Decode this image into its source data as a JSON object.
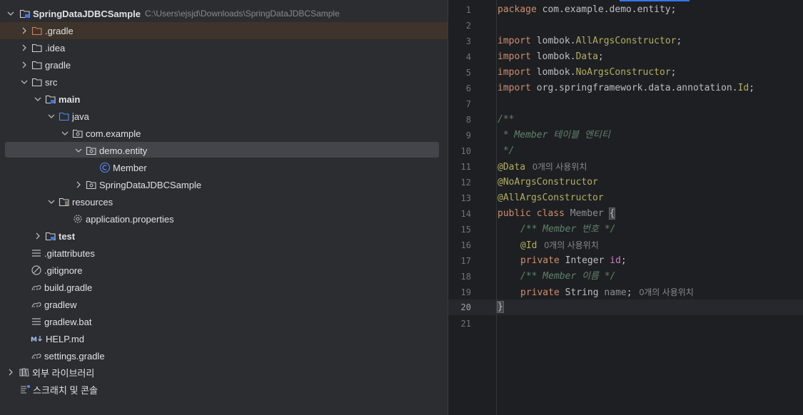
{
  "project_tree": {
    "root": {
      "label": "SpringDataJDBCSample",
      "path": "C:\\Users\\ejsjd\\Downloads\\SpringDataJDBCSample"
    },
    "items": [
      {
        "label": ".gradle",
        "icon": "folder-icon"
      },
      {
        "label": ".idea",
        "icon": "folder-icon"
      },
      {
        "label": "gradle",
        "icon": "folder-icon"
      },
      {
        "label": "src",
        "icon": "folder-icon"
      },
      {
        "label": "main",
        "icon": "module-folder-icon"
      },
      {
        "label": "java",
        "icon": "source-folder-icon"
      },
      {
        "label": "com.example",
        "icon": "package-icon"
      },
      {
        "label": "demo.entity",
        "icon": "package-icon"
      },
      {
        "label": "Member",
        "icon": "class-icon"
      },
      {
        "label": "SpringDataJDBCSample",
        "icon": "package-icon"
      },
      {
        "label": "resources",
        "icon": "resources-folder-icon"
      },
      {
        "label": "application.properties",
        "icon": "gear-icon"
      },
      {
        "label": "test",
        "icon": "module-folder-icon"
      },
      {
        "label": ".gitattributes",
        "icon": "text-file-icon"
      },
      {
        "label": ".gitignore",
        "icon": "ignore-file-icon"
      },
      {
        "label": "build.gradle",
        "icon": "gradle-icon"
      },
      {
        "label": "gradlew",
        "icon": "gradle-icon"
      },
      {
        "label": "gradlew.bat",
        "icon": "text-file-icon"
      },
      {
        "label": "HELP.md",
        "icon": "markdown-icon"
      },
      {
        "label": "settings.gradle",
        "icon": "gradle-icon"
      },
      {
        "label": "외부 라이브러리",
        "icon": "library-icon"
      },
      {
        "label": "스크래치 및 콘솔",
        "icon": "scratch-icon"
      }
    ]
  },
  "editor": {
    "line_numbers": [
      "1",
      "2",
      "3",
      "4",
      "5",
      "6",
      "7",
      "8",
      "9",
      "10",
      "11",
      "12",
      "13",
      "14",
      "15",
      "16",
      "17",
      "18",
      "19",
      "20",
      "21"
    ],
    "current_line": "20",
    "lines": {
      "l1": {
        "kw": "package",
        "rest": " com.example.demo.entity;"
      },
      "l3": {
        "kw": "import",
        "pkg": " lombok.",
        "name": "AllArgsConstructor",
        "end": ";"
      },
      "l4": {
        "kw": "import",
        "pkg": " lombok.",
        "name": "Data",
        "end": ";"
      },
      "l5": {
        "kw": "import",
        "pkg": " lombok.",
        "name": "NoArgsConstructor",
        "end": ";"
      },
      "l6": {
        "kw": "import",
        "pkg": " org.springframework.data.annotation.",
        "name": "Id",
        "end": ";"
      },
      "l8": "/**",
      "l9": " * Member 테이블 엔티티",
      "l10": " */",
      "l11": {
        "ann": "@Data",
        "hint": "0개의 사용위치"
      },
      "l12": "@NoArgsConstructor",
      "l13": "@AllArgsConstructor",
      "l14": {
        "kw1": "public",
        "kw2": "class",
        "name": "Member",
        "brace": "{"
      },
      "l15": "/** Member 번호 */",
      "l16": {
        "ann": "@Id",
        "hint": "0개의 사용위치"
      },
      "l17": {
        "kw": "private",
        "type": " Integer ",
        "field": "id",
        "end": ";"
      },
      "l18": "/** Member 이름 */",
      "l19": {
        "kw": "private",
        "type": " String ",
        "field": "name",
        "end": ";",
        "hint": "0개의 사용위치"
      },
      "l20": "}"
    }
  },
  "colors": {
    "keyword": "#cf8e6d",
    "annotation": "#b3ae60",
    "comment": "#5f826b",
    "field": "#c77dbb",
    "selection": "#43454a",
    "highlight_row": "#3e342b",
    "accent": "#3574f0"
  }
}
